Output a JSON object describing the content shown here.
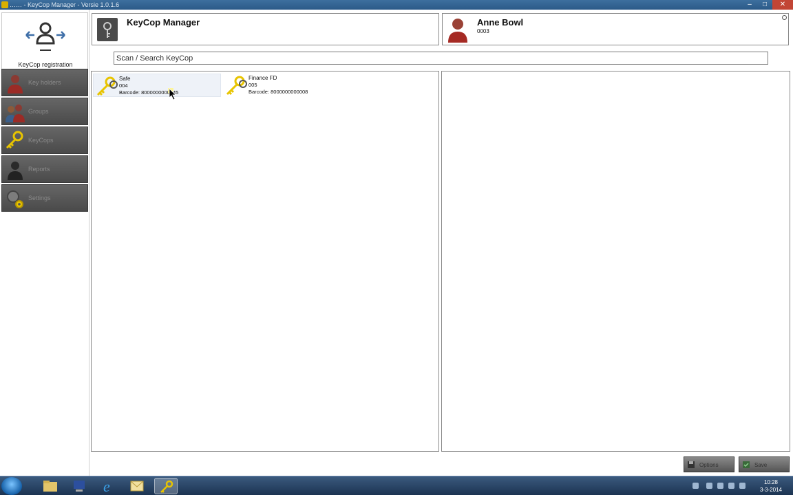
{
  "window": {
    "title": "…… - KeyCop Manager - Versie 1.0.1.6"
  },
  "sidebar": {
    "registration_label": "KeyCop registration",
    "items": [
      {
        "label": "Key holders",
        "icon": "person-icon"
      },
      {
        "label": "Groups",
        "icon": "group-icon"
      },
      {
        "label": "KeyCops",
        "icon": "keys-icon"
      },
      {
        "label": "Reports",
        "icon": "user-silhouette-icon"
      },
      {
        "label": "Settings",
        "icon": "settings-gear-icon"
      }
    ]
  },
  "header_left": {
    "title": "KeyCop Manager"
  },
  "header_right": {
    "name": "Anne Bowl",
    "code": "0003"
  },
  "search": {
    "placeholder": "Scan / Search KeyCop"
  },
  "keys": [
    {
      "name": "Safe",
      "number": "004",
      "barcode": "Barcode: 8000000000045"
    },
    {
      "name": "Finance FD",
      "number": "005",
      "barcode": "Barcode: 8000000000008"
    }
  ],
  "actions": {
    "options_label": "Options",
    "save_label": "Save"
  },
  "taskbar": {
    "time": "10:28",
    "date": "3-3-2014"
  },
  "colors": {
    "nav_bg": "#555555",
    "key_yellow": "#e8c400",
    "close_red": "#c24535"
  }
}
